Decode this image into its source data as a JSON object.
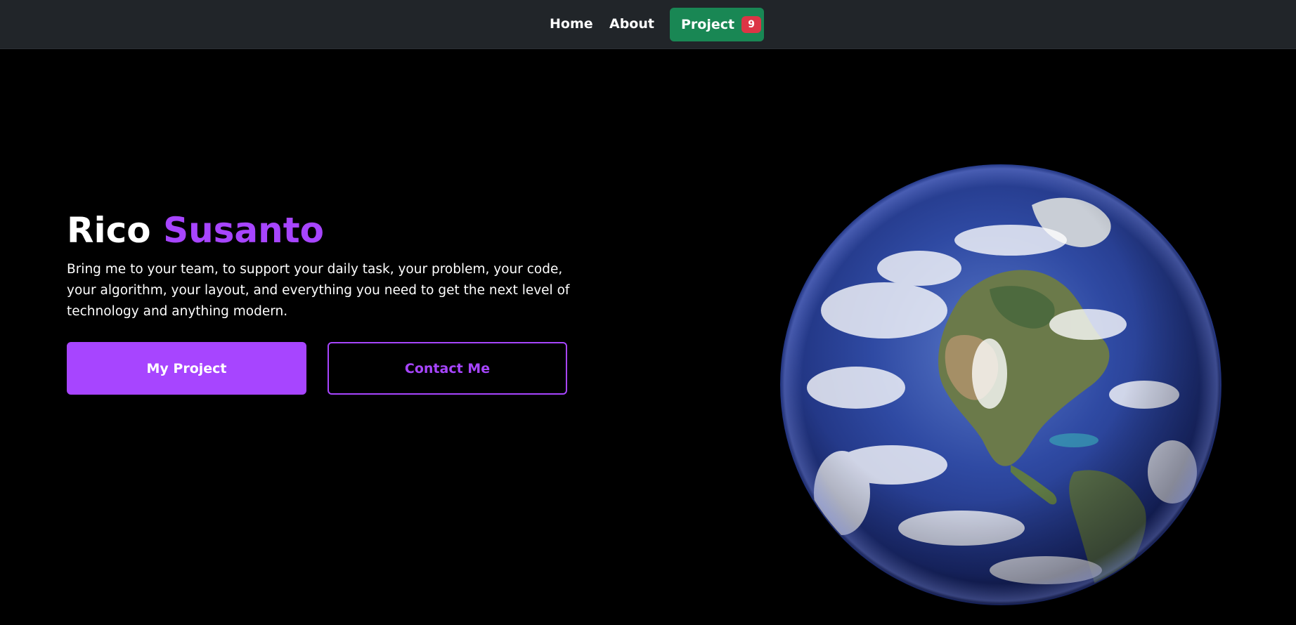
{
  "navbar": {
    "home_label": "Home",
    "about_label": "About",
    "project_label": "Project",
    "project_badge": "9"
  },
  "hero": {
    "first_name": "Rico",
    "last_name": "Susanto",
    "description": "Bring me to your team, to support your daily task, your problem, your code, your algorithm, your layout, and everything you need to get the next level of technology and anything modern.",
    "primary_button": "My Project",
    "secondary_button": "Contact Me"
  },
  "colors": {
    "accent": "#a745ff",
    "navbar_bg": "#212529",
    "project_button_bg": "#198754",
    "badge_bg": "#dc3545",
    "page_bg": "#000000"
  },
  "icons": {
    "hero_image": "earth-globe-image"
  }
}
